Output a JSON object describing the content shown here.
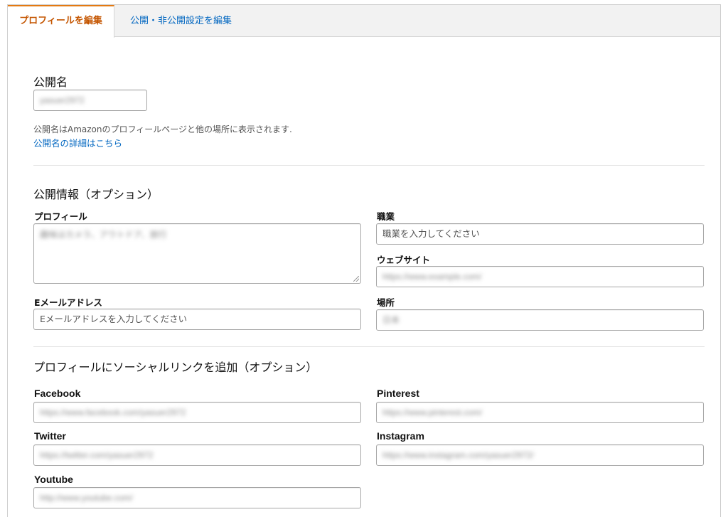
{
  "tabs": [
    {
      "label": "プロフィールを編集",
      "active": true
    },
    {
      "label": "公開・非公開設定を編集",
      "active": false
    }
  ],
  "public_name": {
    "heading": "公開名",
    "value": "yasuer2972",
    "help": "公開名はAmazonのプロフィールページと他の場所に表示されます.",
    "link": "公開名の詳細はこちら"
  },
  "public_info": {
    "heading": "公開情報（オプション）",
    "profile": {
      "label": "プロフィール",
      "value": "趣味はカメラ、アウトドア、旅行"
    },
    "occupation": {
      "label": "職業",
      "placeholder": "職業を入力してください"
    },
    "website": {
      "label": "ウェブサイト",
      "value": "https://www.example.com/"
    },
    "email": {
      "label": "Eメールアドレス",
      "placeholder": "Eメールアドレスを入力してください"
    },
    "location": {
      "label": "場所",
      "value": "日本"
    }
  },
  "social": {
    "heading": "プロフィールにソーシャルリンクを追加（オプション）",
    "facebook": {
      "label": "Facebook",
      "value": "https://www.facebook.com/yasuer2972"
    },
    "pinterest": {
      "label": "Pinterest",
      "value": "https://www.pinterest.com/"
    },
    "twitter": {
      "label": "Twitter",
      "value": "https://twitter.com/yasuer2972"
    },
    "instagram": {
      "label": "Instagram",
      "value": "https://www.instagram.com/yasuer2972/"
    },
    "youtube": {
      "label": "Youtube",
      "value": "http://www.youtube.com/"
    }
  },
  "colors": {
    "accent": "#e47911",
    "active_tab_text": "#c45500",
    "link": "#0066c0"
  }
}
